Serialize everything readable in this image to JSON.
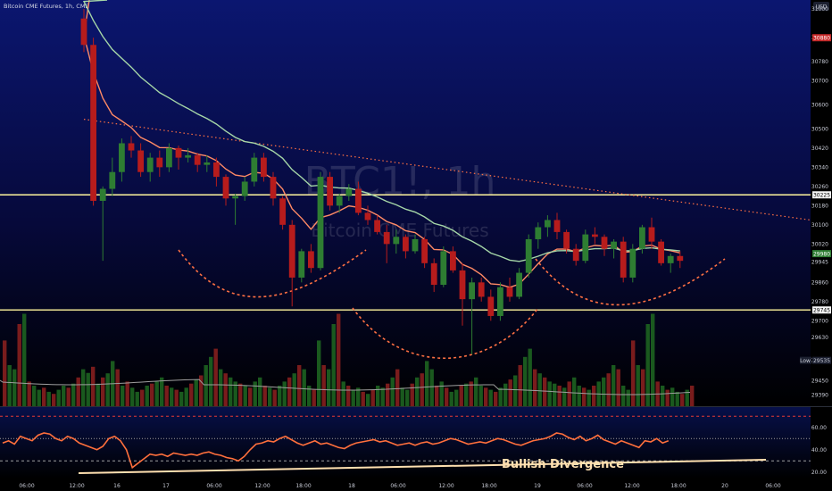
{
  "header": {
    "symbol_title": "Bitcoin CME Futures, 1h, CME"
  },
  "currency": "USD",
  "watermark": {
    "ticker": "BTC1!, 1h",
    "name": "Bitcoin CME Futures"
  },
  "colors": {
    "up": "#2e7d32",
    "down": "#b71c1c",
    "ema_fast": "#ff8a65",
    "ema_slow": "#a5d6a7",
    "rsi": "#ff6f3c",
    "trend": "#ff7043",
    "support": "#fff59d"
  },
  "chart_data": [
    {
      "type": "candlestick",
      "title": "",
      "y_ticks": [
        "31000",
        "30880",
        "30780",
        "30700",
        "30600",
        "30500",
        "30420",
        "30340",
        "30260",
        "30180",
        "30100",
        "30020",
        "29945",
        "29860",
        "29780",
        "29700",
        "29630",
        "29535",
        "29450",
        "29390"
      ],
      "ylim": [
        29370,
        31000
      ],
      "x_ticks": [
        "06:00",
        "12:00",
        "16",
        "17",
        "06:00",
        "12:00",
        "18:00",
        "18",
        "06:00",
        "12:00",
        "18:00",
        "19",
        "06:00",
        "12:00",
        "18:00",
        "20",
        "06:00"
      ],
      "price_badges": [
        {
          "label": "30880",
          "value": 30880,
          "kind": "red"
        },
        {
          "label": "30225",
          "value": 30225,
          "kind": "white"
        },
        {
          "label": "29980",
          "value": 29980,
          "kind": "green"
        },
        {
          "label": "29745",
          "value": 29745,
          "kind": "white"
        },
        {
          "label": "Low",
          "value": 29535,
          "kind": "low",
          "extra": "29535"
        }
      ],
      "support_levels": [
        30225,
        29745
      ],
      "candles": [
        [
          30960,
          31000,
          30820,
          30850
        ],
        [
          30850,
          30880,
          30180,
          30200
        ],
        [
          30200,
          30260,
          29950,
          30250
        ],
        [
          30250,
          30380,
          30220,
          30320
        ],
        [
          30320,
          30460,
          30280,
          30440
        ],
        [
          30440,
          30470,
          30380,
          30410
        ],
        [
          30410,
          30440,
          30300,
          30320
        ],
        [
          30320,
          30400,
          30280,
          30380
        ],
        [
          30380,
          30410,
          30300,
          30340
        ],
        [
          30340,
          30440,
          30320,
          30420
        ],
        [
          30420,
          30430,
          30330,
          30380
        ],
        [
          30380,
          30420,
          30360,
          30390
        ],
        [
          30390,
          30400,
          30320,
          30350
        ],
        [
          30350,
          30390,
          30320,
          30360
        ],
        [
          30360,
          30380,
          30260,
          30300
        ],
        [
          30300,
          30310,
          30180,
          30210
        ],
        [
          30210,
          30230,
          30100,
          30220
        ],
        [
          30220,
          30300,
          30200,
          30280
        ],
        [
          30280,
          30400,
          30260,
          30380
        ],
        [
          30380,
          30400,
          30280,
          30300
        ],
        [
          30300,
          30320,
          30180,
          30210
        ],
        [
          30210,
          30220,
          30080,
          30100
        ],
        [
          30100,
          30120,
          29760,
          29880
        ],
        [
          29880,
          30000,
          29860,
          29990
        ],
        [
          29990,
          30020,
          29900,
          29920
        ],
        [
          29920,
          30320,
          29910,
          30300
        ],
        [
          30300,
          30320,
          30160,
          30180
        ],
        [
          30180,
          30230,
          30150,
          30220
        ],
        [
          30220,
          30270,
          30200,
          30250
        ],
        [
          30250,
          30280,
          30140,
          30150
        ],
        [
          30150,
          30180,
          30100,
          30120
        ],
        [
          30120,
          30140,
          30060,
          30070
        ],
        [
          30070,
          30100,
          29940,
          30020
        ],
        [
          30020,
          30080,
          29980,
          30050
        ],
        [
          30050,
          30060,
          29960,
          29990
        ],
        [
          29990,
          30060,
          29980,
          30040
        ],
        [
          30040,
          30050,
          29920,
          29940
        ],
        [
          29940,
          29960,
          29820,
          29850
        ],
        [
          29850,
          30010,
          29840,
          29990
        ],
        [
          29990,
          30010,
          29900,
          29910
        ],
        [
          29910,
          29940,
          29680,
          29790
        ],
        [
          29790,
          29880,
          29560,
          29860
        ],
        [
          29860,
          29880,
          29780,
          29800
        ],
        [
          29800,
          29830,
          29700,
          29720
        ],
        [
          29720,
          29860,
          29700,
          29840
        ],
        [
          29840,
          29880,
          29780,
          29800
        ],
        [
          29800,
          29920,
          29790,
          29900
        ],
        [
          29900,
          30060,
          29880,
          30040
        ],
        [
          30040,
          30110,
          30000,
          30090
        ],
        [
          30090,
          30140,
          30050,
          30120
        ],
        [
          30120,
          30150,
          30040,
          30070
        ],
        [
          30070,
          30080,
          29980,
          30000
        ],
        [
          30000,
          30020,
          29930,
          29950
        ],
        [
          29950,
          30080,
          29940,
          30060
        ],
        [
          30060,
          30090,
          30020,
          30050
        ],
        [
          30050,
          30060,
          29970,
          30000
        ],
        [
          30000,
          30040,
          29960,
          30030
        ],
        [
          30030,
          30050,
          29860,
          29880
        ],
        [
          29880,
          30020,
          29860,
          30000
        ],
        [
          30000,
          30100,
          29980,
          30090
        ],
        [
          30090,
          30130,
          30000,
          30030
        ],
        [
          30030,
          30040,
          29930,
          29940
        ],
        [
          29940,
          29980,
          29900,
          29970
        ],
        [
          29970,
          29990,
          29920,
          29950
        ]
      ]
    },
    {
      "type": "bar",
      "title": "Volume",
      "values": [
        32,
        20,
        18,
        40,
        45,
        12,
        10,
        8,
        9,
        7,
        6,
        8,
        10,
        9,
        11,
        14,
        18,
        9,
        8,
        11,
        14,
        16,
        22,
        18,
        10,
        12,
        9,
        7,
        8,
        10,
        11,
        12,
        14,
        10,
        9,
        8,
        7,
        9,
        11,
        13,
        15,
        20,
        24,
        28,
        18,
        16,
        14,
        12,
        11,
        10,
        9,
        12,
        14,
        10,
        9,
        8,
        10,
        12,
        14,
        16,
        20,
        18,
        10,
        8
      ]
    },
    {
      "type": "line",
      "title": "RSI",
      "y_ticks": [
        "60.00",
        "40.00",
        "20.00"
      ],
      "ylim": [
        15,
        75
      ],
      "series": [
        {
          "name": "",
          "values": [
            46,
            48,
            45,
            52,
            50,
            48,
            53,
            55,
            54,
            50,
            48,
            52,
            50,
            46,
            44,
            42,
            40,
            43,
            50,
            52,
            48,
            40,
            24,
            28,
            32,
            36,
            35,
            36,
            34,
            37,
            36,
            35,
            36,
            35,
            37,
            38,
            36,
            35,
            33,
            32,
            30,
            34,
            40,
            45,
            46,
            48,
            47,
            50,
            52,
            49,
            46,
            44,
            46,
            48,
            45,
            46,
            44,
            42,
            41,
            44,
            46,
            47,
            48,
            49,
            47,
            48,
            46,
            44,
            45,
            46,
            44,
            46,
            47,
            45,
            46,
            48,
            50,
            49,
            47,
            45,
            46,
            47,
            46,
            48,
            50,
            49,
            47,
            45,
            44,
            46,
            48,
            49,
            50,
            52,
            55,
            54,
            51,
            49,
            52,
            48,
            50,
            53,
            49,
            47,
            45,
            48,
            46,
            44,
            42,
            48,
            47,
            50,
            46,
            48
          ]
        }
      ],
      "levels": [
        70,
        50,
        30
      ]
    }
  ],
  "annotations": {
    "divergence_label": "Bullish Divergence"
  }
}
